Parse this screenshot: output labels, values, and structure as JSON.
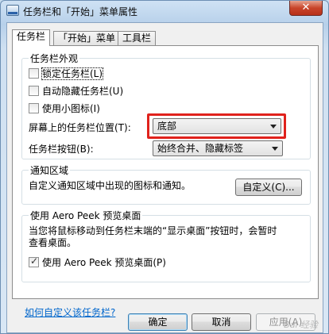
{
  "window": {
    "title": "任务栏和「开始」菜单属性",
    "close_glyph": "✕"
  },
  "tabs": [
    {
      "label": "任务栏",
      "active": true
    },
    {
      "label": "「开始」菜单",
      "active": false
    },
    {
      "label": "工具栏",
      "active": false
    }
  ],
  "appearance": {
    "group_label": "任务栏外观",
    "lock_taskbar": {
      "label": "锁定任务栏(L)",
      "checked": false
    },
    "auto_hide": {
      "label": "自动隐藏任务栏(U)",
      "checked": false
    },
    "small_icons": {
      "label": "使用小图标(I)",
      "checked": false
    },
    "location": {
      "label": "屏幕上的任务栏位置(T):",
      "value": "底部"
    },
    "buttons": {
      "label": "任务栏按钮(B):",
      "value": "始终合并、隐藏标签"
    }
  },
  "notification": {
    "group_label": "通知区域",
    "description": "自定义通知区域中出现的图标和通知。",
    "customize_button": "自定义(C)..."
  },
  "aero_peek": {
    "group_label": "使用 Aero Peek 预览桌面",
    "description_line1": "当您将鼠标移动到任务栏末端的“显示桌面”按钮时，会暂时",
    "description_line2": "查看桌面。",
    "checkbox": {
      "label": "使用 Aero Peek 预览桌面(P)",
      "checked": true
    }
  },
  "help_link": "如何自定义该任务栏?",
  "footer": {
    "ok": "确定",
    "cancel": "取消",
    "apply": "应用(A)"
  },
  "colors": {
    "highlight": "#e0221c",
    "link": "#0066cc"
  },
  "watermark": "Bai 经验"
}
